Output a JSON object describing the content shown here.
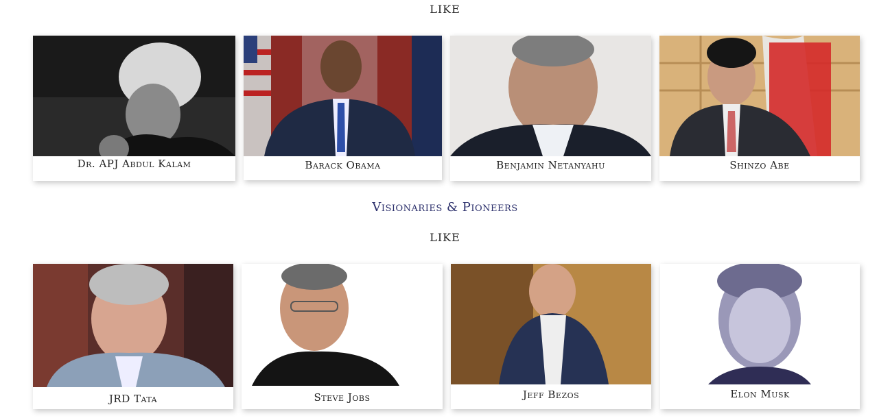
{
  "sections": [
    {
      "like_label": "LIKE",
      "people": [
        {
          "name": "Dr. APJ Abdul Kalam",
          "photo_icon": "kalam-portrait"
        },
        {
          "name": "Barack Obama",
          "photo_icon": "obama-portrait"
        },
        {
          "name": "Benjamin Netanyahu",
          "photo_icon": "netanyahu-portrait"
        },
        {
          "name": "Shinzo Abe",
          "photo_icon": "abe-portrait"
        }
      ]
    },
    {
      "title": "Visionaries & Pioneers",
      "like_label": "LIKE",
      "people": [
        {
          "name": "JRD Tata",
          "photo_icon": "tata-portrait"
        },
        {
          "name": "Steve Jobs",
          "photo_icon": "jobs-portrait"
        },
        {
          "name": "Jeff Bezos",
          "photo_icon": "bezos-portrait"
        },
        {
          "name": "Elon Musk",
          "photo_icon": "musk-portrait"
        }
      ]
    }
  ],
  "colors": {
    "section_title": "#2b2f6b",
    "text": "#222222",
    "background": "#ffffff"
  }
}
